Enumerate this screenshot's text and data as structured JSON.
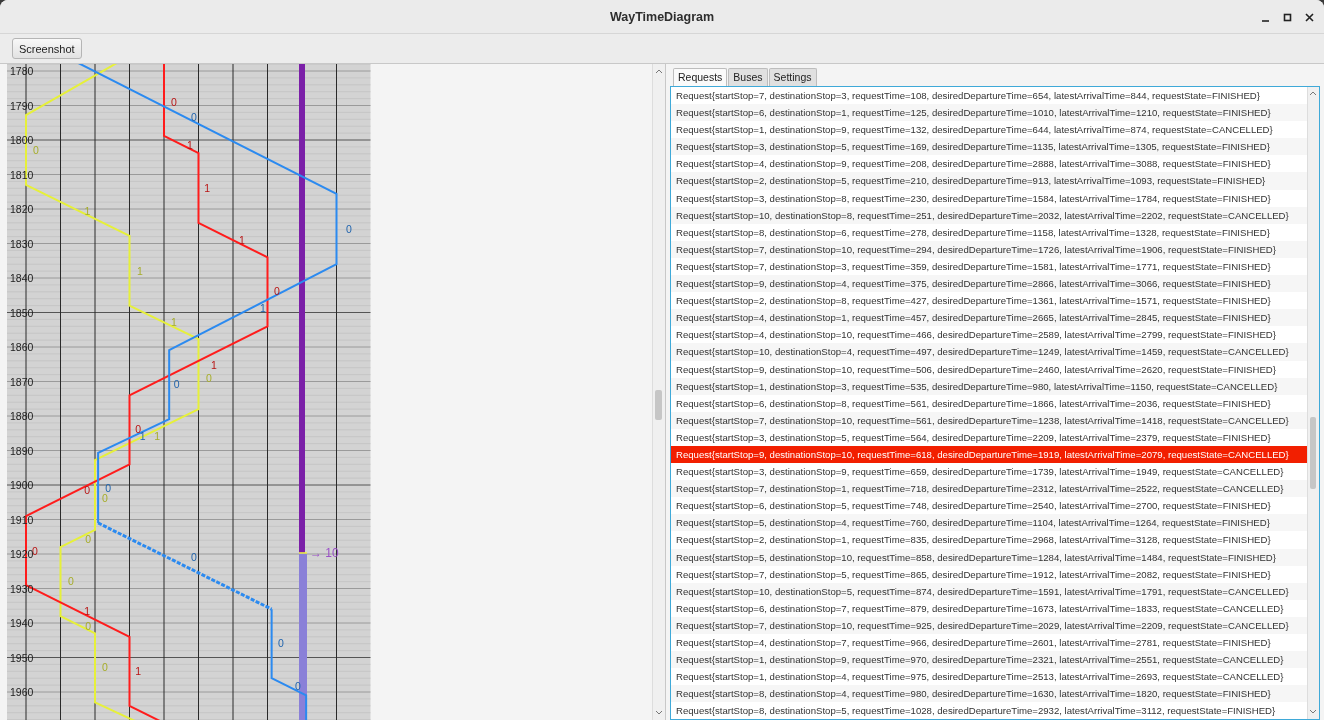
{
  "window": {
    "title": "WayTimeDiagram"
  },
  "toolbar": {
    "button": "Screenshot"
  },
  "diagram": {
    "y_ticks": [
      "1780",
      "1790",
      "1800",
      "1810",
      "1820",
      "1830",
      "1840",
      "1850",
      "1860",
      "1870",
      "1880",
      "1890",
      "1900",
      "1910",
      "1920",
      "1930",
      "1940",
      "1950",
      "1960"
    ],
    "routes": [
      {
        "color": "#e6f03a",
        "labels": [
          "0",
          "1",
          "1",
          "1",
          "0",
          "1",
          "0",
          "0",
          "0",
          "0",
          "0"
        ]
      },
      {
        "color": "#ff1c1c",
        "labels": [
          "0",
          "1",
          "1",
          "1",
          "0",
          "1",
          "0",
          "0",
          "0",
          "1",
          "1"
        ]
      },
      {
        "color": "#2b8af0",
        "labels": [
          "0",
          "0",
          "1",
          "0",
          "1",
          "0"
        ]
      },
      {
        "color": "#2b8af0",
        "labels": [
          "0"
        ]
      },
      {
        "color": "#2b8af0",
        "labels": [
          "0",
          "0"
        ]
      }
    ],
    "marker": {
      "label": "→ 10"
    }
  },
  "tabs": [
    {
      "label": "Requests",
      "selected": true
    },
    {
      "label": "Buses",
      "selected": false
    },
    {
      "label": "Settings",
      "selected": false
    }
  ],
  "requests": [
    {
      "text": "Request{startStop=7, destinationStop=3, requestTime=108, desiredDepartureTime=654, latestArrivalTime=844, requestState=FINISHED}",
      "selected": false
    },
    {
      "text": "Request{startStop=6, destinationStop=1, requestTime=125, desiredDepartureTime=1010, latestArrivalTime=1210, requestState=FINISHED}",
      "selected": false
    },
    {
      "text": "Request{startStop=1, destinationStop=9, requestTime=132, desiredDepartureTime=644, latestArrivalTime=874, requestState=CANCELLED}",
      "selected": false
    },
    {
      "text": "Request{startStop=3, destinationStop=5, requestTime=169, desiredDepartureTime=1135, latestArrivalTime=1305, requestState=FINISHED}",
      "selected": false
    },
    {
      "text": "Request{startStop=4, destinationStop=9, requestTime=208, desiredDepartureTime=2888, latestArrivalTime=3088, requestState=FINISHED}",
      "selected": false
    },
    {
      "text": "Request{startStop=2, destinationStop=5, requestTime=210, desiredDepartureTime=913, latestArrivalTime=1093, requestState=FINISHED}",
      "selected": false
    },
    {
      "text": "Request{startStop=3, destinationStop=8, requestTime=230, desiredDepartureTime=1584, latestArrivalTime=1784, requestState=FINISHED}",
      "selected": false
    },
    {
      "text": "Request{startStop=10, destinationStop=8, requestTime=251, desiredDepartureTime=2032, latestArrivalTime=2202, requestState=CANCELLED}",
      "selected": false
    },
    {
      "text": "Request{startStop=8, destinationStop=6, requestTime=278, desiredDepartureTime=1158, latestArrivalTime=1328, requestState=FINISHED}",
      "selected": false
    },
    {
      "text": "Request{startStop=7, destinationStop=10, requestTime=294, desiredDepartureTime=1726, latestArrivalTime=1906, requestState=FINISHED}",
      "selected": false
    },
    {
      "text": "Request{startStop=7, destinationStop=3, requestTime=359, desiredDepartureTime=1581, latestArrivalTime=1771, requestState=FINISHED}",
      "selected": false
    },
    {
      "text": "Request{startStop=9, destinationStop=4, requestTime=375, desiredDepartureTime=2866, latestArrivalTime=3066, requestState=FINISHED}",
      "selected": false
    },
    {
      "text": "Request{startStop=2, destinationStop=8, requestTime=427, desiredDepartureTime=1361, latestArrivalTime=1571, requestState=FINISHED}",
      "selected": false
    },
    {
      "text": "Request{startStop=4, destinationStop=1, requestTime=457, desiredDepartureTime=2665, latestArrivalTime=2845, requestState=FINISHED}",
      "selected": false
    },
    {
      "text": "Request{startStop=4, destinationStop=10, requestTime=466, desiredDepartureTime=2589, latestArrivalTime=2799, requestState=FINISHED}",
      "selected": false
    },
    {
      "text": "Request{startStop=10, destinationStop=4, requestTime=497, desiredDepartureTime=1249, latestArrivalTime=1459, requestState=CANCELLED}",
      "selected": false
    },
    {
      "text": "Request{startStop=9, destinationStop=10, requestTime=506, desiredDepartureTime=2460, latestArrivalTime=2620, requestState=FINISHED}",
      "selected": false
    },
    {
      "text": "Request{startStop=1, destinationStop=3, requestTime=535, desiredDepartureTime=980, latestArrivalTime=1150, requestState=CANCELLED}",
      "selected": false
    },
    {
      "text": "Request{startStop=6, destinationStop=8, requestTime=561, desiredDepartureTime=1866, latestArrivalTime=2036, requestState=FINISHED}",
      "selected": false
    },
    {
      "text": "Request{startStop=7, destinationStop=10, requestTime=561, desiredDepartureTime=1238, latestArrivalTime=1418, requestState=CANCELLED}",
      "selected": false
    },
    {
      "text": "Request{startStop=3, destinationStop=5, requestTime=564, desiredDepartureTime=2209, latestArrivalTime=2379, requestState=FINISHED}",
      "selected": false
    },
    {
      "text": "Request{startStop=9, destinationStop=10, requestTime=618, desiredDepartureTime=1919, latestArrivalTime=2079, requestState=CANCELLED}",
      "selected": true
    },
    {
      "text": "Request{startStop=3, destinationStop=9, requestTime=659, desiredDepartureTime=1739, latestArrivalTime=1949, requestState=CANCELLED}",
      "selected": false
    },
    {
      "text": "Request{startStop=7, destinationStop=1, requestTime=718, desiredDepartureTime=2312, latestArrivalTime=2522, requestState=CANCELLED}",
      "selected": false
    },
    {
      "text": "Request{startStop=6, destinationStop=5, requestTime=748, desiredDepartureTime=2540, latestArrivalTime=2700, requestState=FINISHED}",
      "selected": false
    },
    {
      "text": "Request{startStop=5, destinationStop=4, requestTime=760, desiredDepartureTime=1104, latestArrivalTime=1264, requestState=FINISHED}",
      "selected": false
    },
    {
      "text": "Request{startStop=2, destinationStop=1, requestTime=835, desiredDepartureTime=2968, latestArrivalTime=3128, requestState=FINISHED}",
      "selected": false
    },
    {
      "text": "Request{startStop=5, destinationStop=10, requestTime=858, desiredDepartureTime=1284, latestArrivalTime=1484, requestState=FINISHED}",
      "selected": false
    },
    {
      "text": "Request{startStop=7, destinationStop=5, requestTime=865, desiredDepartureTime=1912, latestArrivalTime=2082, requestState=FINISHED}",
      "selected": false
    },
    {
      "text": "Request{startStop=10, destinationStop=5, requestTime=874, desiredDepartureTime=1591, latestArrivalTime=1791, requestState=CANCELLED}",
      "selected": false
    },
    {
      "text": "Request{startStop=6, destinationStop=7, requestTime=879, desiredDepartureTime=1673, latestArrivalTime=1833, requestState=CANCELLED}",
      "selected": false
    },
    {
      "text": "Request{startStop=7, destinationStop=10, requestTime=925, desiredDepartureTime=2029, latestArrivalTime=2209, requestState=CANCELLED}",
      "selected": false
    },
    {
      "text": "Request{startStop=4, destinationStop=7, requestTime=966, desiredDepartureTime=2601, latestArrivalTime=2781, requestState=FINISHED}",
      "selected": false
    },
    {
      "text": "Request{startStop=1, destinationStop=9, requestTime=970, desiredDepartureTime=2321, latestArrivalTime=2551, requestState=CANCELLED}",
      "selected": false
    },
    {
      "text": "Request{startStop=1, destinationStop=4, requestTime=975, desiredDepartureTime=2513, latestArrivalTime=2693, requestState=CANCELLED}",
      "selected": false
    },
    {
      "text": "Request{startStop=8, destinationStop=4, requestTime=980, desiredDepartureTime=1630, latestArrivalTime=1820, requestState=FINISHED}",
      "selected": false
    },
    {
      "text": "Request{startStop=8, destinationStop=5, requestTime=1028, desiredDepartureTime=2932, latestArrivalTime=3112, requestState=FINISHED}",
      "selected": false
    }
  ]
}
